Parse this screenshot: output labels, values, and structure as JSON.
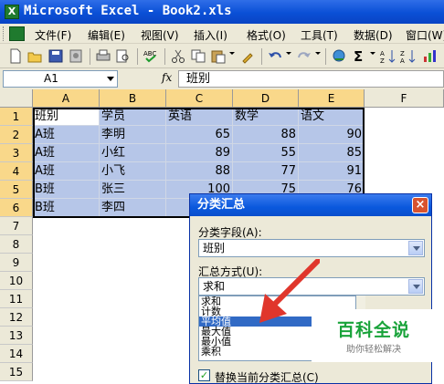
{
  "window": {
    "title": "Microsoft Excel - Book2.xls"
  },
  "menu": [
    "文件(F)",
    "编辑(E)",
    "视图(V)",
    "插入(I)",
    "格式(O)",
    "工具(T)",
    "数据(D)",
    "窗口(W)"
  ],
  "toolbar": {
    "icons": [
      "new-icon",
      "open-icon",
      "save-icon",
      "permission-icon",
      "print-icon",
      "print-preview-icon",
      "spelling-icon",
      "cut-icon",
      "copy-icon",
      "paste-icon",
      "format-painter-icon",
      "undo-icon",
      "redo-icon",
      "hyperlink-icon",
      "autosum-icon",
      "sort-ascending-icon",
      "sort-descending-icon"
    ]
  },
  "formula": {
    "name_box": "A1",
    "fx": "fx",
    "content": "班别"
  },
  "columns": [
    "A",
    "B",
    "C",
    "D",
    "E",
    "F"
  ],
  "rows": [
    "1",
    "2",
    "3",
    "4",
    "5",
    "6",
    "7",
    "8",
    "9",
    "10",
    "11",
    "12",
    "13",
    "14",
    "15"
  ],
  "table": {
    "headers": [
      "班别",
      "学员",
      "英语",
      "数学",
      "语文"
    ],
    "data": [
      [
        "A班",
        "李明",
        "65",
        "88",
        "90"
      ],
      [
        "A班",
        "小红",
        "89",
        "55",
        "85"
      ],
      [
        "A班",
        "小飞",
        "88",
        "77",
        "91"
      ],
      [
        "B班",
        "张三",
        "100",
        "75",
        "76"
      ],
      [
        "B班",
        "李四",
        "",
        "",
        ""
      ]
    ]
  },
  "dialog": {
    "title": "分类汇总",
    "close": "×",
    "group_label": "分类字段(A):",
    "group_value": "班别",
    "method_label": "汇总方式(U):",
    "method_value": "求和",
    "options": [
      "求和",
      "计数",
      "平均值",
      "最大值",
      "最小值",
      "乘积"
    ],
    "selected_option": "平均值",
    "replace_checked": "✓",
    "replace_label": "替换当前分类汇总(C)"
  },
  "watermark": {
    "title": "百科全说",
    "subtitle": "助你轻松解决"
  }
}
